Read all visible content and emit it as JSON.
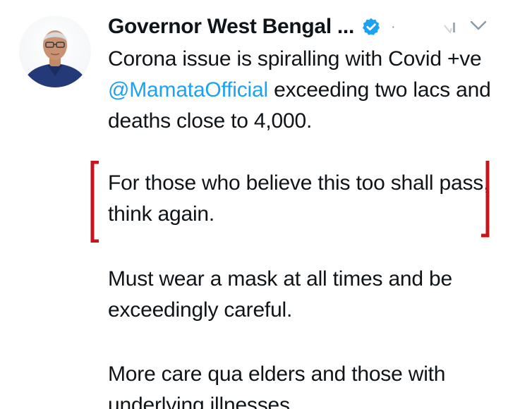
{
  "tweet": {
    "author_name": "Governor West Bengal ...",
    "separator": "·",
    "avatar": "avatar-photo",
    "verified_icon": "verified-badge-icon",
    "menu_icon": "chevron-down-icon",
    "paragraphs": {
      "p1_before_mention": "Corona issue is spiralling with Covid +ve ",
      "p1_mention": "@MamataOfficial",
      "p1_after_mention": " exceeding two lacs and deaths close to 4,000.",
      "p2": "For those who believe this too shall pass, think again.",
      "p3": "Must wear a mask at all times and be exceedingly careful.",
      "p4": "More care qua elders and those with underlying illnesses."
    },
    "colors": {
      "text": "#0f1419",
      "mention": "#1da1f2",
      "verified": "#1da1f2",
      "annotation_bracket": "#c4161c",
      "muted": "#8899a6"
    },
    "annotation": "red-brackets"
  }
}
